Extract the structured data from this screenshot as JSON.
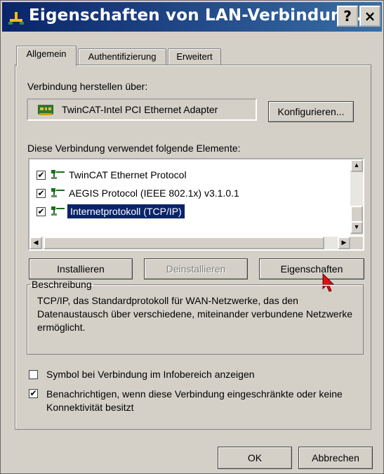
{
  "window": {
    "title": "Eigenschaften von LAN-Verbindun...",
    "help_btn": "?",
    "close_btn": "×"
  },
  "tabs": [
    "Allgemein",
    "Authentifizierung",
    "Erweitert"
  ],
  "connection": {
    "label": "Verbindung herstellen über:",
    "adapter": "TwinCAT-Intel PCI Ethernet Adapter",
    "configure_btn": "Konfigurieren..."
  },
  "elements": {
    "label": "Diese Verbindung verwendet folgende Elemente:",
    "items": [
      {
        "label": "TwinCAT Ethernet Protocol",
        "checked": true,
        "selected": false
      },
      {
        "label": "AEGIS Protocol (IEEE 802.1x) v3.1.0.1",
        "checked": true,
        "selected": false
      },
      {
        "label": "Internetprotokoll (TCP/IP)",
        "checked": true,
        "selected": true
      }
    ]
  },
  "buttons": {
    "install": "Installieren",
    "uninstall": "Deinstallieren",
    "properties": "Eigenschaften"
  },
  "description": {
    "legend": "Beschreibung",
    "text": "TCP/IP, das Standardprotokoll für WAN-Netzwerke, das den Datenaustausch über verschiedene, miteinander verbundene Netzwerke ermöglicht."
  },
  "options": {
    "show_icon": {
      "label": "Symbol bei Verbindung im Infobereich anzeigen",
      "checked": false
    },
    "notify": {
      "label": "Benachrichtigen, wenn diese Verbindung eingeschränkte oder keine Konnektivität besitzt",
      "checked": true
    }
  },
  "footer": {
    "ok": "OK",
    "cancel": "Abbrechen"
  },
  "colors": {
    "title_bar": "#0a246a",
    "face": "#d4d0c8",
    "selection": "#0a246a"
  }
}
